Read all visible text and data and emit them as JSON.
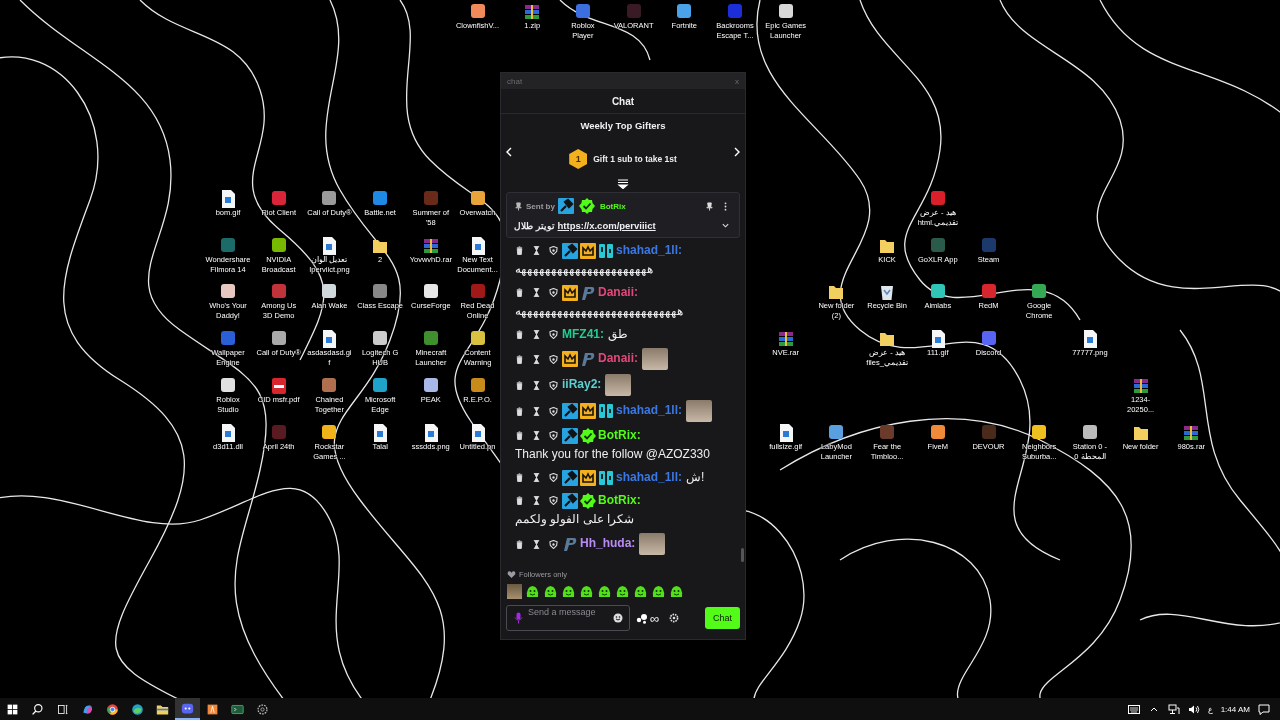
{
  "desktop": {
    "icons": [
      {
        "label": "ClownfishV...",
        "kind": "app",
        "color": "#f08a5a"
      },
      {
        "label": "1.zip",
        "kind": "archive"
      },
      {
        "label": "Roblox Player",
        "kind": "app",
        "color": "#3b6fe0"
      },
      {
        "label": "VALORANT",
        "kind": "app",
        "color": "#3a1a24"
      },
      {
        "label": "Fortnite",
        "kind": "app",
        "color": "#4aa3e8"
      },
      {
        "label": "Backrooms Escape T...",
        "kind": "app",
        "color": "#1c2ed8"
      },
      {
        "label": "Epic Games Launcher",
        "kind": "app",
        "color": "#d8d8d8"
      },
      {
        "label": "bom.gif",
        "kind": "file"
      },
      {
        "label": "Riot Client",
        "kind": "app",
        "color": "#d9243a"
      },
      {
        "label": "Call of Duty®",
        "kind": "app",
        "color": "#9a9a9a"
      },
      {
        "label": "Battle.net",
        "kind": "app",
        "color": "#1e8ae6"
      },
      {
        "label": "Summer of '58",
        "kind": "app",
        "color": "#6a2a1a"
      },
      {
        "label": "Overwatch",
        "kind": "app",
        "color": "#e8a33a"
      },
      {
        "label": "هيد - عرض تقديمي.html",
        "kind": "app",
        "color": "#d81f2a"
      },
      {
        "label": "Wondershare Filmora 14",
        "kind": "app",
        "color": "#1c6b6b"
      },
      {
        "label": "NVIDIA Broadcast",
        "kind": "app",
        "color": "#76b900"
      },
      {
        "label": "تعديل الوان Iperviict.png",
        "kind": "file"
      },
      {
        "label": "2",
        "kind": "folder"
      },
      {
        "label": "YovwvhD.rar",
        "kind": "archive"
      },
      {
        "label": "New Text Document...",
        "kind": "file"
      },
      {
        "label": "KICK",
        "kind": "folder"
      },
      {
        "label": "GoXLR App",
        "kind": "app",
        "color": "#2b5a4a"
      },
      {
        "label": "Steam",
        "kind": "app",
        "color": "#1b3a6b"
      },
      {
        "label": "Who's Your Daddy!",
        "kind": "app",
        "color": "#e8c7c0"
      },
      {
        "label": "Among Us 3D Demo",
        "kind": "app",
        "color": "#c2323a"
      },
      {
        "label": "Alan Wake",
        "kind": "app",
        "color": "#cfd8dc"
      },
      {
        "label": "Class Escape",
        "kind": "app",
        "color": "#888888"
      },
      {
        "label": "CurseForge",
        "kind": "app",
        "color": "#e6e6e6"
      },
      {
        "label": "Red Dead Online",
        "kind": "app",
        "color": "#a01818"
      },
      {
        "label": "New folder (2)",
        "kind": "folder"
      },
      {
        "label": "Recycle Bin",
        "kind": "bin"
      },
      {
        "label": "Aimlabs",
        "kind": "app",
        "color": "#2fc6b8"
      },
      {
        "label": "RedM",
        "kind": "app",
        "color": "#d8262e"
      },
      {
        "label": "Google Chrome",
        "kind": "app",
        "color": "#34a853"
      },
      {
        "label": "Wallpaper Engine",
        "kind": "app",
        "color": "#2a5fd8"
      },
      {
        "label": "Call of Duty®",
        "kind": "app",
        "color": "#aaaaaa"
      },
      {
        "label": "asdasdasd.gif",
        "kind": "file"
      },
      {
        "label": "Logitech G HUB",
        "kind": "app",
        "color": "#cccccc"
      },
      {
        "label": "Minecraft Launcher",
        "kind": "app",
        "color": "#3f8f2f"
      },
      {
        "label": "Content Warning",
        "kind": "app",
        "color": "#d8c040"
      },
      {
        "label": "NVE.rar",
        "kind": "archive"
      },
      {
        "label": "هيد - عرض تقديمي_files",
        "kind": "folder"
      },
      {
        "label": "111.gif",
        "kind": "file"
      },
      {
        "label": "Discord",
        "kind": "app",
        "color": "#5865f2"
      },
      {
        "label": "77777.png",
        "kind": "file"
      },
      {
        "label": "Roblox Studio",
        "kind": "app",
        "color": "#e0e0e0"
      },
      {
        "label": "CID msfr.pdf",
        "kind": "pdf"
      },
      {
        "label": "Chained Together",
        "kind": "app",
        "color": "#b07050"
      },
      {
        "label": "Microsoft Edge",
        "kind": "app",
        "color": "#1fa3c8"
      },
      {
        "label": "PEAK",
        "kind": "app",
        "color": "#a8b8e8"
      },
      {
        "label": "R.E.P.O.",
        "kind": "app",
        "color": "#c88a1a"
      },
      {
        "label": "1234-20250...",
        "kind": "archive"
      },
      {
        "label": "d3d11.dll",
        "kind": "file"
      },
      {
        "label": "April 24th",
        "kind": "app",
        "color": "#5a1a22"
      },
      {
        "label": "Rockstar Games ...",
        "kind": "app",
        "color": "#f2b21a"
      },
      {
        "label": "Talal",
        "kind": "file"
      },
      {
        "label": "sssdds.png",
        "kind": "file"
      },
      {
        "label": "Untitled.pn",
        "kind": "file"
      },
      {
        "label": "fullsize.gif",
        "kind": "file"
      },
      {
        "label": "LabyMod Launcher",
        "kind": "app",
        "color": "#5aa0e0"
      },
      {
        "label": "Fear the Timbloo...",
        "kind": "app",
        "color": "#6a3a2a"
      },
      {
        "label": "FiveM",
        "kind": "app",
        "color": "#f08a3a"
      },
      {
        "label": "DEVOUR",
        "kind": "app",
        "color": "#4a2a1a"
      },
      {
        "label": "Neighbors Suburba...",
        "kind": "app",
        "color": "#f0c020"
      },
      {
        "label": "Station 0 - المحطة 0",
        "kind": "app",
        "color": "#bbbbbb"
      },
      {
        "label": "New folder",
        "kind": "folder"
      },
      {
        "label": "980s.rar",
        "kind": "archive"
      }
    ]
  },
  "chat": {
    "title": "chat",
    "close": "x",
    "header": "Chat",
    "gifters": {
      "title": "Weekly Top Gifters",
      "rank": "1",
      "text": "Gift 1 sub to take 1st"
    },
    "pinned": {
      "label": "Sent by",
      "badges": [
        {
          "kind": "mod"
        },
        {
          "kind": "verified"
        }
      ],
      "user": "BotRix",
      "color": "#53fc18",
      "text": "تويتر طلال",
      "link": "https://x.com/perviiict"
    },
    "messages": [
      {
        "badges": [
          {
            "kind": "mod"
          },
          {
            "kind": "sub"
          },
          {
            "kind": "og"
          }
        ],
        "user": "shahad_1ll:",
        "color": "#3a78e6",
        "text": "ههههههههههههههههههههههه"
      },
      {
        "badges": [
          {
            "kind": "sub"
          },
          {
            "kind": "p"
          }
        ],
        "user": "Danaii:",
        "color": "#e0497a",
        "text": "هههههههههههههههههههههههههههه"
      },
      {
        "user": "MFZ41:",
        "color": "#1fcf8f",
        "text": "طق"
      },
      {
        "badges": [
          {
            "kind": "sub"
          },
          {
            "kind": "p"
          }
        ],
        "user": "Danaii:",
        "color": "#e0497a",
        "emote": true
      },
      {
        "user": "iiRay2:",
        "color": "#5cd0d0",
        "emote": true
      },
      {
        "badges": [
          {
            "kind": "mod"
          },
          {
            "kind": "sub"
          },
          {
            "kind": "og"
          }
        ],
        "user": "shahad_1ll:",
        "color": "#3a78e6",
        "emote": true
      },
      {
        "badges": [
          {
            "kind": "mod"
          },
          {
            "kind": "verified"
          }
        ],
        "user": "BotRix:",
        "color": "#53fc18",
        "text": "Thank you for the follow @AZOZ330"
      },
      {
        "badges": [
          {
            "kind": "mod"
          },
          {
            "kind": "sub"
          },
          {
            "kind": "og"
          }
        ],
        "user": "shahad_1ll:",
        "color": "#3a78e6",
        "text": "ش!"
      },
      {
        "badges": [
          {
            "kind": "mod"
          },
          {
            "kind": "verified"
          }
        ],
        "user": "BotRix:",
        "color": "#53fc18",
        "text": "شكرا على الفولو ولكمم"
      },
      {
        "badges": [
          {
            "kind": "p"
          }
        ],
        "user": "Hh_huda:",
        "color": "#b98bf5",
        "emote": true
      }
    ],
    "mode": "Followers only",
    "emotes": [
      {
        "kind": "photo"
      },
      {
        "kind": "blob"
      },
      {
        "kind": "blob"
      },
      {
        "kind": "blob"
      },
      {
        "kind": "blob"
      },
      {
        "kind": "blob"
      },
      {
        "kind": "blob"
      },
      {
        "kind": "blob"
      },
      {
        "kind": "blob"
      },
      {
        "kind": "blob"
      }
    ],
    "composer": {
      "placeholder": "Send a message",
      "points": "∞",
      "button": "Chat"
    }
  },
  "taskbar": {
    "apps": [
      {
        "kind": "start",
        "selected": false
      },
      {
        "kind": "search",
        "selected": false
      },
      {
        "kind": "taskview",
        "selected": false
      },
      {
        "kind": "copilot",
        "selected": false
      },
      {
        "kind": "chrome",
        "selected": false
      },
      {
        "kind": "edge",
        "selected": false
      },
      {
        "kind": "explorer",
        "selected": false
      },
      {
        "kind": "discord",
        "selected": true
      },
      {
        "kind": "orange",
        "selected": false
      },
      {
        "kind": "terminal",
        "selected": false
      },
      {
        "kind": "gear",
        "selected": false
      }
    ],
    "tray": {
      "language": "ع",
      "time": "1:44 AM"
    }
  }
}
